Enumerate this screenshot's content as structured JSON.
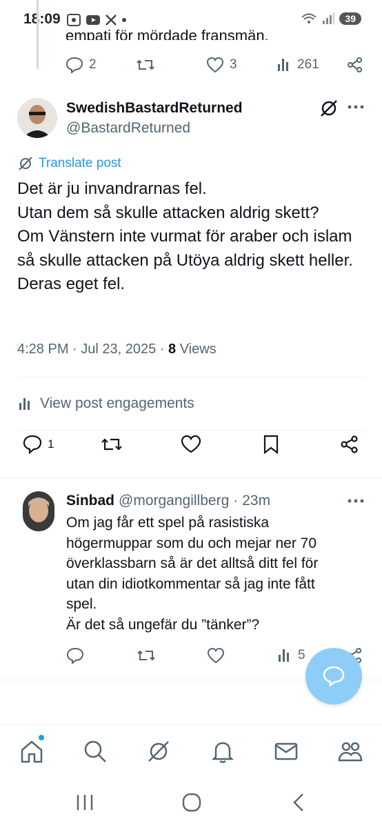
{
  "status_bar": {
    "time": "18:09",
    "battery": "39"
  },
  "previous_tweet": {
    "text_fragment": "empati för mördade fransmän.",
    "replies": "2",
    "likes": "3",
    "views": "261"
  },
  "main_tweet": {
    "display_name": "SwedishBastardReturned",
    "handle": "@BastardReturned",
    "translate_label": "Translate post",
    "body": "Det är ju invandrarnas fel.\nUtan dem så skulle attacken aldrig skett?\nOm Vänstern inte vurmat för araber och islam så skulle attacken på Utöya aldrig skett heller.\nDeras eget fel.",
    "time": "4:28 PM · Jul 23, 2025 · ",
    "views_count": "8",
    "views_label": " Views",
    "engagements_label": "View post engagements",
    "reply_count": "1"
  },
  "reply": {
    "display_name": "Sinbad",
    "handle": "@morgangillberg",
    "age": "23m",
    "separator": "·",
    "body": "Om jag får ett spel på rasistiska högermuppar som du och  mejar ner 70 överklassbarn så är det alltså ditt fel för utan din idiotkommentar så jag inte fått spel.\nÄr det så ungefär du ”tänker”?",
    "views": "5"
  },
  "colors": {
    "accent": "#1d9bf0",
    "text": "#0f1419",
    "muted": "#536471",
    "fab": "#8ecdf8"
  }
}
